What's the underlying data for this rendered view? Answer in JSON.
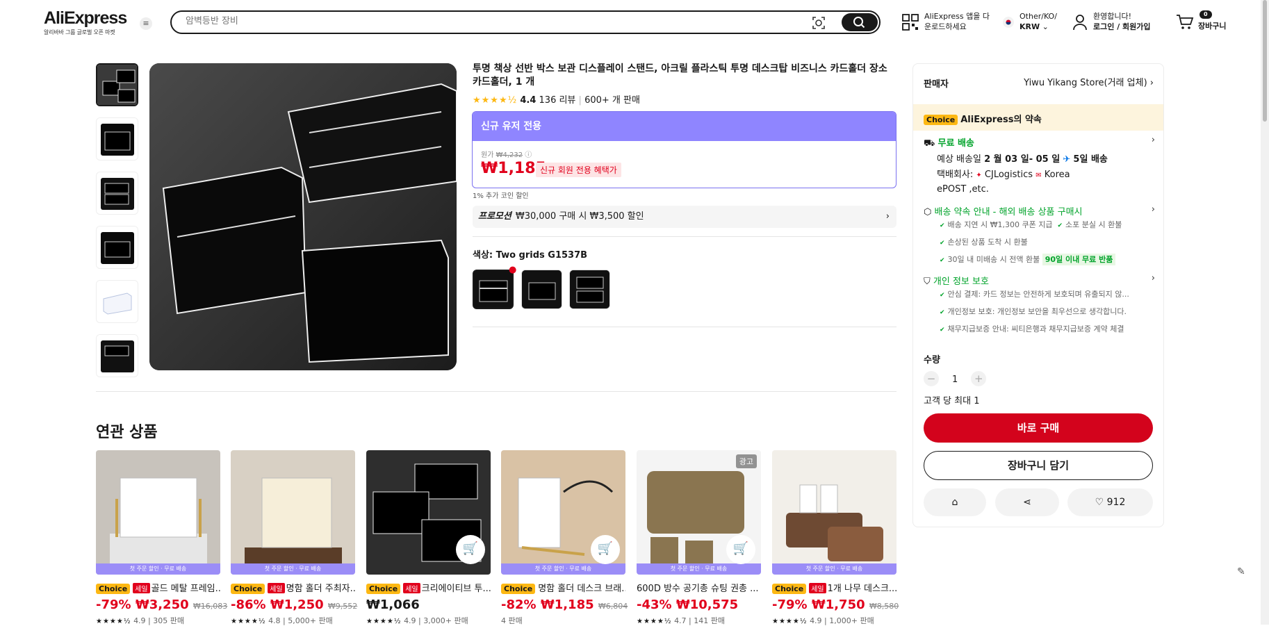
{
  "header": {
    "logo": "AliExpress",
    "logo_sub": "알리바바 그룹 글로벌 오픈 마켓",
    "search_placeholder": "암벽등반 장비",
    "app_line1": "AliExpress 앱을 다",
    "app_line2": "운로드하세요",
    "locale_line1": "Other/KO/",
    "locale_line2": "KRW",
    "account_line1": "환영합니다!",
    "account_line2": "로그인 / 회원가입",
    "cart_count": "0",
    "cart_label": "장바구니"
  },
  "product": {
    "title": "투명 책상 선반 박스 보관 디스플레이 스탠드, 아크릴 플라스틱 투명 데스크탑 비즈니스 카드홀더 장소 카드홀더, 1 개",
    "rating": "4.4",
    "reviews": "136 리뷰",
    "sold": "600+ 개 판매",
    "new_user_label": "신규 유저 전용",
    "orig_label": "원가",
    "orig_price": "₩4,232",
    "price": "₩1,185",
    "price_tag": "신규 회원 전용 혜택가",
    "coin": "1% 추가 코인 할인",
    "promo_label": "프로모션",
    "promo_text": "₩30,000 구매 시 ₩3,500 할인",
    "color_label": "색상: Two grids G1537B"
  },
  "panel": {
    "seller_label": "판매자",
    "seller_name": "Yiwu Yikang Store(거래 업체)",
    "choice_badge": "Choice",
    "choice_promise": "AliExpress의 약속",
    "free_ship": "무료 배송",
    "delivery_prefix": "예상 배송일",
    "delivery_dates": "2 월 03 일- 05 일",
    "delivery_days": "5일 배송",
    "carrier_label": "택배회사:",
    "carrier1": "CJLogistics",
    "carrier2": "Korea",
    "carrier3": "ePOST ,etc.",
    "ship_promise": "배송 약속 안내 - 해외 배송 상품 구매시",
    "sp1": "배송 지연 시 ₩1,300 쿠폰 지급",
    "sp2": "소포 분실 시 환불",
    "sp3": "손상된 상품 도착 시 환불",
    "sp4": "30일 내 미배송 시 전액 환불",
    "sp4_tag": "90일 이내 무료 반품",
    "privacy": "개인 정보 보호",
    "pv1": "안심 결제: 카드 정보는 안전하게 보호되며 유출되지 않...",
    "pv2": "개인정보 보호: 개인정보 보안을 최우선으로 생각합니다.",
    "pv3": "채무지급보증 안내: 씨티은행과 채무지급보증 계약 체결",
    "qty_label": "수량",
    "qty": "1",
    "max_label": "고객 당 최대 1",
    "buy_now": "바로 구매",
    "add_cart": "장바구니 담기",
    "wish_count": "912"
  },
  "related": {
    "heading": "연관 상품",
    "banner": "첫 주문 할인 · 무료 배송",
    "ad_label": "광고",
    "items": [
      {
        "choice": "Choice",
        "sale": "세일",
        "title": "골드 메탈 프레임...",
        "discount": "-79%",
        "price": "₩3,250",
        "orig": "₩16,083",
        "rating": "4.9",
        "sold": "305 판매"
      },
      {
        "choice": "Choice",
        "sale": "세일",
        "title": "명함 홀더 주최자...",
        "discount": "-86%",
        "price": "₩1,250",
        "orig": "₩9,552",
        "rating": "4.8",
        "sold": "5,000+ 판매"
      },
      {
        "choice": "Choice",
        "sale": "세일",
        "title": "크리에이티브 투...",
        "discount": "",
        "price": "₩1,066",
        "orig": "",
        "rating": "4.9",
        "sold": "3,000+ 판매"
      },
      {
        "choice": "Choice",
        "sale": "",
        "title": "명함 홀더 데스크 브래...",
        "discount": "-82%",
        "price": "₩1,185",
        "orig": "₩6,804",
        "rating": "",
        "sold": "4 판매"
      },
      {
        "choice": "",
        "sale": "",
        "title": "600D 방수 공기총 슈팅 권총 ...",
        "discount": "-43%",
        "price": "₩10,575",
        "orig": "",
        "rating": "4.7",
        "sold": "141 판매"
      },
      {
        "choice": "Choice",
        "sale": "세일",
        "title": "1개 나무 데스크...",
        "discount": "-79%",
        "price": "₩1,750",
        "orig": "₩8,580",
        "rating": "4.9",
        "sold": "1,000+ 판매"
      }
    ]
  },
  "icons": [
    "menu-icon",
    "camera-search-icon",
    "search-icon",
    "qr-icon",
    "korea-flag-icon",
    "user-icon",
    "cart-icon",
    "store-icon",
    "share-icon",
    "heart-icon",
    "edit-icon"
  ],
  "colors": {
    "price_red": "#e1001c",
    "buy_red": "#d3031c",
    "new_user_purple": "#8f85ff",
    "choice_yellow": "#fdb813",
    "green": "#00a32a"
  }
}
